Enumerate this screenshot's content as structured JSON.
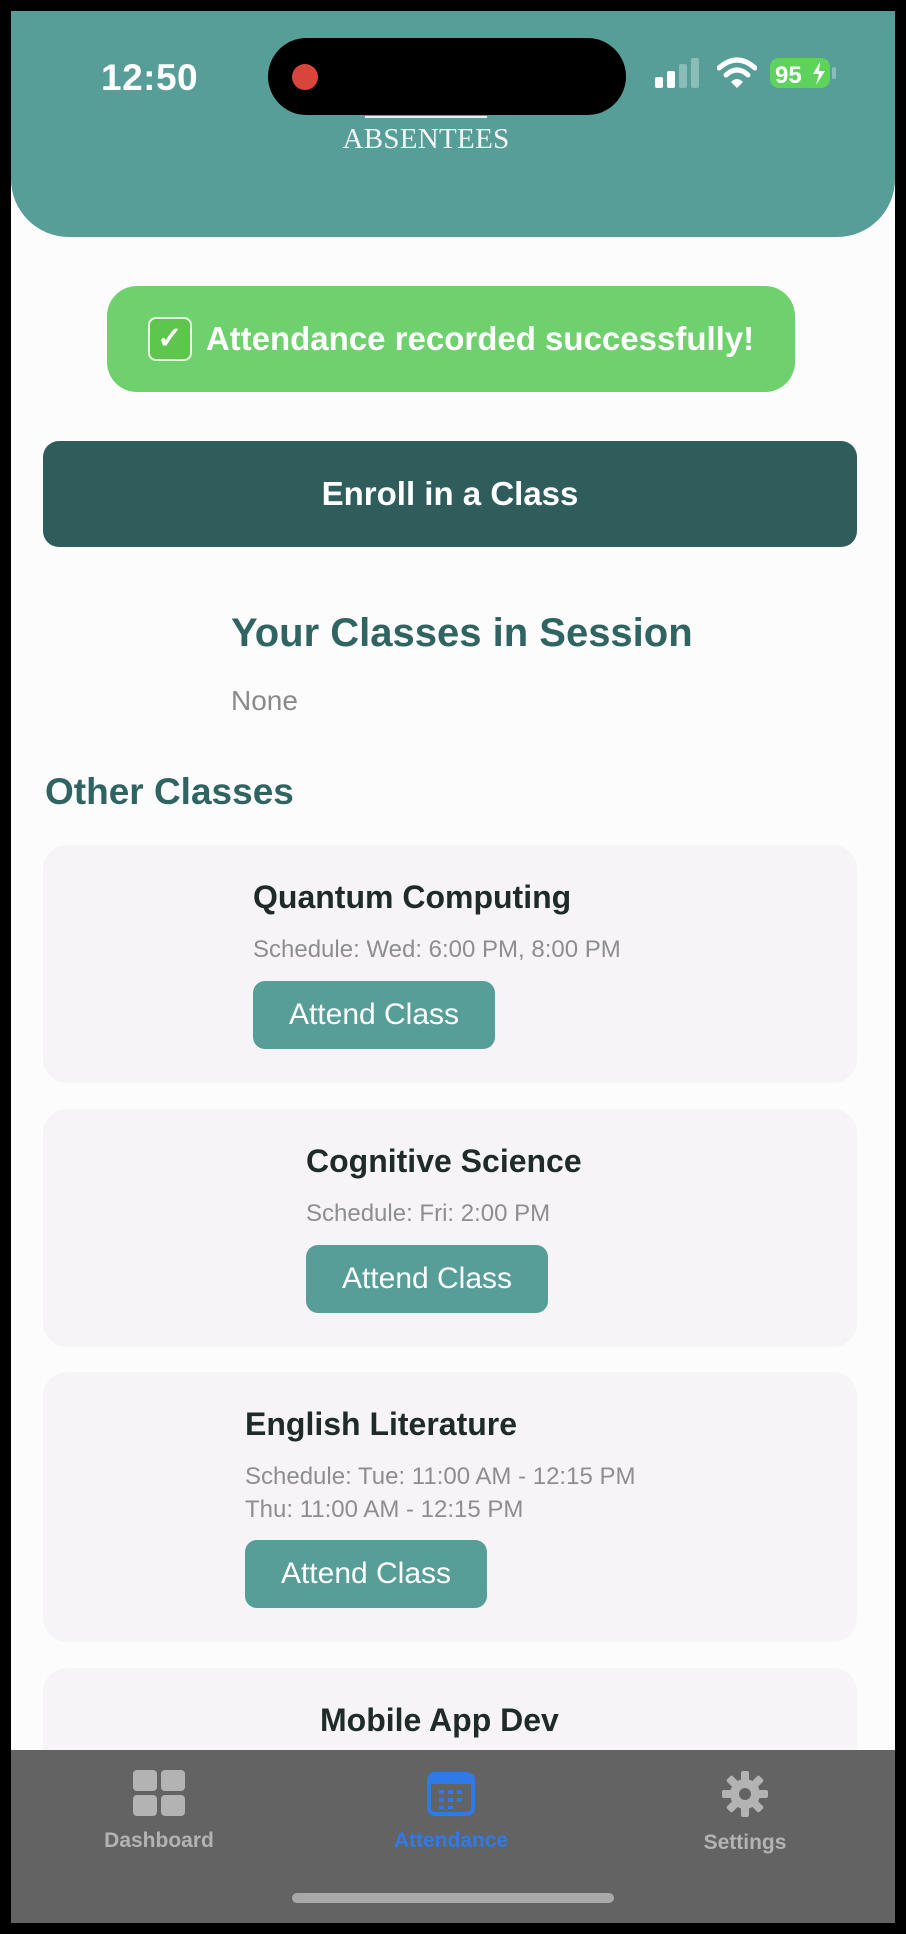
{
  "status_bar": {
    "time": "12:50",
    "battery": "95"
  },
  "header": {
    "brand": "ABSENTEES"
  },
  "toast": {
    "icon": "✓",
    "message": "Attendance recorded successfully!"
  },
  "enroll_button": "Enroll in a Class",
  "session": {
    "title": "Your Classes in Session",
    "empty": "None"
  },
  "other": {
    "title": "Other Classes",
    "classes": [
      {
        "name": "Quantum Computing",
        "schedule": [
          "Schedule: Wed: 6:00 PM, 8:00 PM"
        ],
        "button": "Attend Class"
      },
      {
        "name": "Cognitive Science",
        "schedule": [
          "Schedule: Fri: 2:00 PM"
        ],
        "button": "Attend Class"
      },
      {
        "name": "English Literature",
        "schedule": [
          "Schedule: Tue: 11:00 AM - 12:15 PM",
          "Thu: 11:00 AM - 12:15 PM"
        ],
        "button": "Attend Class"
      },
      {
        "name": "Mobile App Dev"
      }
    ]
  },
  "tabbar": {
    "items": [
      {
        "label": "Dashboard",
        "icon": "grid-icon"
      },
      {
        "label": "Attendance",
        "icon": "calendar-icon",
        "active": true
      },
      {
        "label": "Settings",
        "icon": "gear-icon"
      }
    ]
  },
  "colors": {
    "header": "#579e98",
    "toast": "#6fd16d",
    "enroll": "#2e5d5b",
    "heading": "#2f6462",
    "active_tab": "#2f7ae6"
  }
}
